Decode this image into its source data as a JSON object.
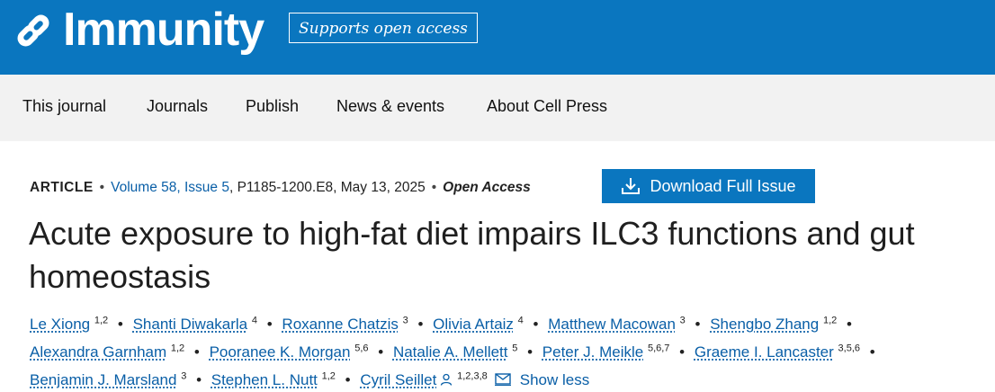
{
  "header": {
    "journal_name": "Immunity",
    "access_badge": "Supports open access",
    "logo_icon": "cell-press-link-icon"
  },
  "nav": {
    "items": [
      "This journal",
      "Journals",
      "Publish",
      "News & events",
      "About Cell Press"
    ]
  },
  "meta": {
    "type": "ARTICLE",
    "volume_issue": "Volume 58, Issue 5",
    "pages_date": "P1185-1200.E8, May 13, 2025",
    "access": "Open Access"
  },
  "download": {
    "label": "Download Full Issue",
    "icon": "download-icon"
  },
  "article": {
    "title": "Acute exposure to high-fat diet impairs ILC3 functions and gut homeostasis"
  },
  "authors": [
    {
      "name": "Le Xiong",
      "aff": "1,2"
    },
    {
      "name": "Shanti Diwakarla",
      "aff": "4"
    },
    {
      "name": "Roxanne Chatzis",
      "aff": "3"
    },
    {
      "name": "Olivia Artaiz",
      "aff": "4"
    },
    {
      "name": "Matthew Macowan",
      "aff": "3"
    },
    {
      "name": "Shengbo Zhang",
      "aff": "1,2"
    },
    {
      "name": "Alexandra Garnham",
      "aff": "1,2"
    },
    {
      "name": "Pooranee K. Morgan",
      "aff": "5,6"
    },
    {
      "name": "Natalie A. Mellett",
      "aff": "5"
    },
    {
      "name": "Peter J. Meikle",
      "aff": "5,6,7"
    },
    {
      "name": "Graeme I. Lancaster",
      "aff": "3,5,6"
    },
    {
      "name": "Benjamin J. Marsland",
      "aff": "3"
    },
    {
      "name": "Stephen L. Nutt",
      "aff": "1,2"
    },
    {
      "name": "Cyril Seillet",
      "aff": "1,2,3,8"
    }
  ],
  "authors_toggle": "Show less",
  "colors": {
    "brand": "#0a76bf",
    "link": "#0a5fa7",
    "nav_bg": "#f2f2f2"
  }
}
